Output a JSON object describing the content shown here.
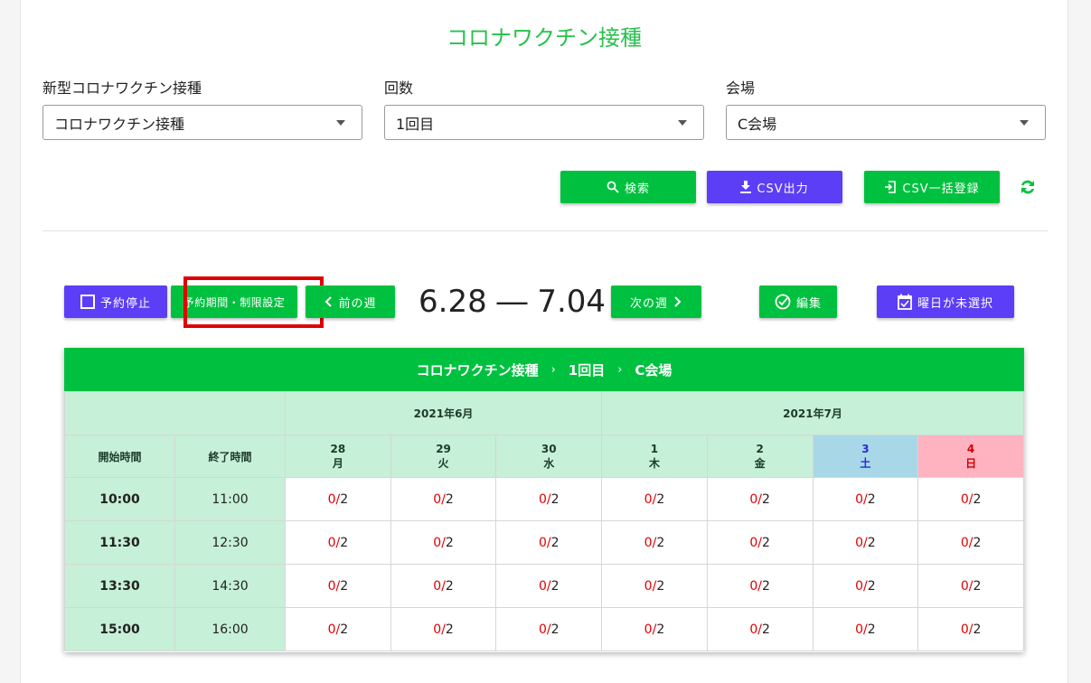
{
  "page_title": "コロナワクチン接種",
  "filters": [
    {
      "label": "新型コロナワクチン接種",
      "value": "コロナワクチン接種"
    },
    {
      "label": "回数",
      "value": "1回目"
    },
    {
      "label": "会場",
      "value": "C会場"
    }
  ],
  "actions": {
    "search": "検索",
    "csv_export": "CSV出力",
    "csv_import": "CSV一括登録"
  },
  "toolbar": {
    "suspend": "予約停止",
    "period": "予約期間・制限設定",
    "prev_week": "前の週",
    "week_range": "6.28 ― 7.04",
    "next_week": "次の週",
    "edit": "編集",
    "weekday_unselected": "曜日が未選択"
  },
  "table": {
    "breadcrumb": [
      "コロナワクチン接種",
      "1回目",
      "C会場"
    ],
    "months": [
      "2021年6月",
      "2021年7月"
    ],
    "col_start": "開始時間",
    "col_end": "終了時間",
    "days": [
      {
        "d": "28",
        "w": "月"
      },
      {
        "d": "29",
        "w": "火"
      },
      {
        "d": "30",
        "w": "水"
      },
      {
        "d": "1",
        "w": "木"
      },
      {
        "d": "2",
        "w": "金"
      },
      {
        "d": "3",
        "w": "土"
      },
      {
        "d": "4",
        "w": "日"
      }
    ],
    "rows": [
      {
        "start": "10:00",
        "end": "11:00",
        "booked": "0",
        "cap": "2"
      },
      {
        "start": "11:30",
        "end": "12:30",
        "booked": "0",
        "cap": "2"
      },
      {
        "start": "13:30",
        "end": "14:30",
        "booked": "0",
        "cap": "2"
      },
      {
        "start": "15:00",
        "end": "16:00",
        "booked": "0",
        "cap": "2"
      }
    ],
    "slash": "/"
  },
  "colors": {
    "accent": "#00c13f",
    "purple": "#5b3ef5",
    "highlight": "#e00000"
  }
}
